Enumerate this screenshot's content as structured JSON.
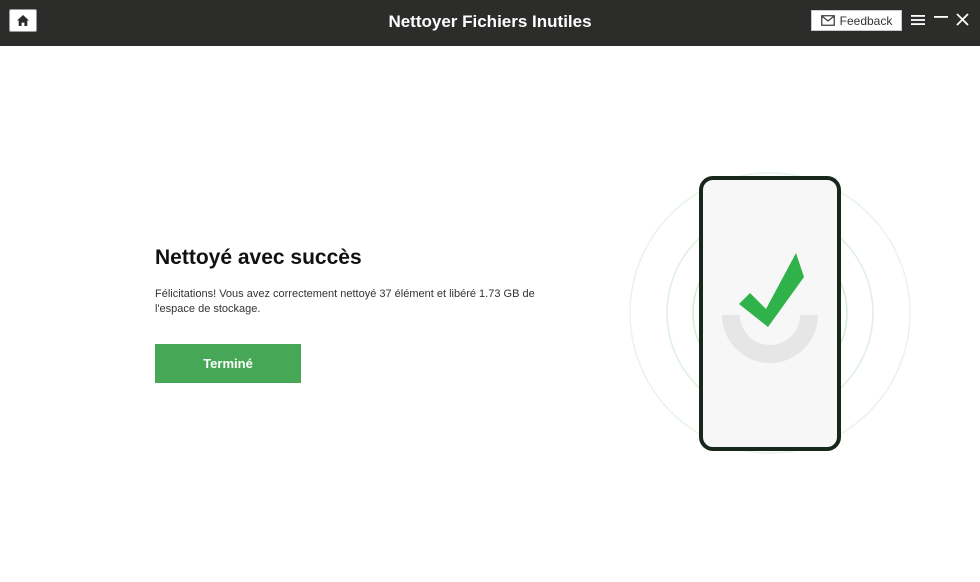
{
  "window": {
    "title": "Nettoyer Fichiers Inutiles",
    "feedback_label": "Feedback",
    "icons": [
      "home-icon",
      "mail-icon",
      "menu-icon",
      "minimize-icon",
      "close-icon"
    ]
  },
  "result": {
    "heading": "Nettoyé avec succès",
    "message": "Félicitations! Vous avez correctement nettoyé 37 élément et libéré 1.73 GB de l'espace de stockage.",
    "done_label": "Terminé"
  },
  "colors": {
    "titlebar": "#2c2d2b",
    "accent_green": "#46a757",
    "check_green": "#2fb24a",
    "phone_frame": "#17271b"
  }
}
